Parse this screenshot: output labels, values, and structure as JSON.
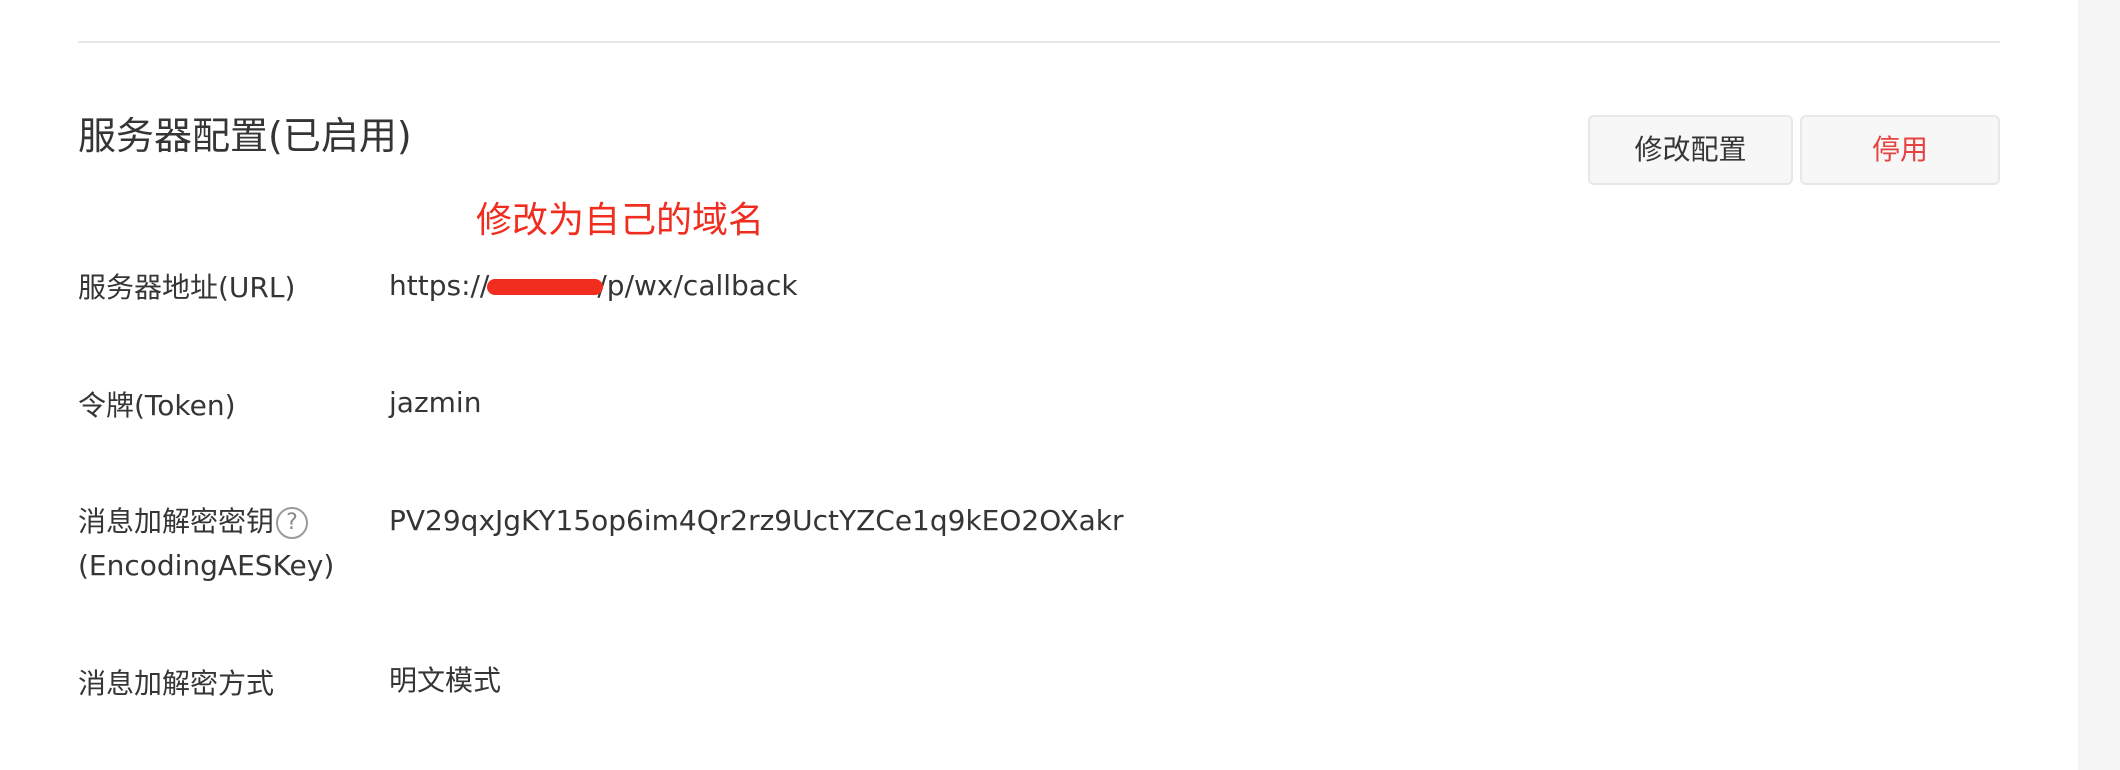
{
  "section": {
    "title": "服务器配置(已启用)",
    "buttons": {
      "modify": "修改配置",
      "disable": "停用"
    }
  },
  "annotation": {
    "text": "修改为自己的域名",
    "color": "#f02d1e"
  },
  "fields": {
    "url": {
      "label": "服务器地址(URL)",
      "value_prefix": "https://",
      "value_redacted": "",
      "value_suffix": "/p/wx/callback"
    },
    "token": {
      "label": "令牌(Token)",
      "value": "jazmin"
    },
    "aes_key": {
      "label_line1": "消息加解密密钥",
      "label_line2": "(EncodingAESKey)",
      "help": "?",
      "value": "PV29qxJgKY15op6im4Qr2rz9UctYZCe1q9kEO2OXakr"
    },
    "encrypt_mode": {
      "label": "消息加解密方式",
      "value": "明文模式"
    }
  },
  "icons": {
    "help": "question-circle-icon"
  },
  "colors": {
    "danger": "#e64340",
    "annotation_red": "#f02d1e",
    "text": "#353535"
  }
}
